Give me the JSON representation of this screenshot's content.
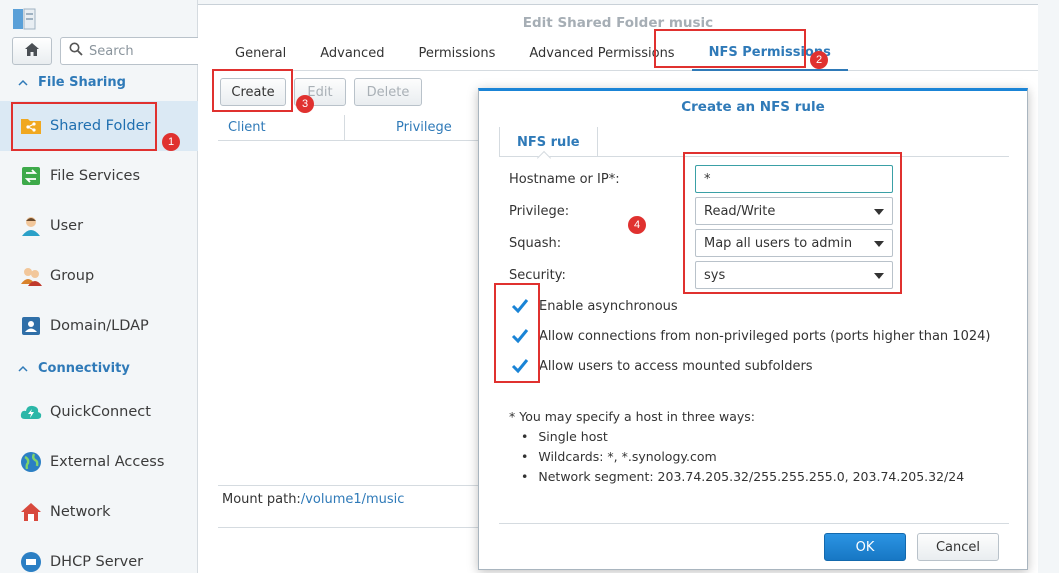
{
  "sidebar": {
    "search_placeholder": "Search",
    "sections": {
      "file_sharing": "File Sharing",
      "connectivity": "Connectivity"
    },
    "items": [
      {
        "label": "Shared Folder",
        "icon": "shared-folder-icon"
      },
      {
        "label": "File Services",
        "icon": "file-services-icon"
      },
      {
        "label": "User",
        "icon": "user-icon"
      },
      {
        "label": "Group",
        "icon": "group-icon"
      },
      {
        "label": "Domain/LDAP",
        "icon": "domain-ldap-icon"
      },
      {
        "label": "QuickConnect",
        "icon": "quickconnect-icon"
      },
      {
        "label": "External Access",
        "icon": "external-access-icon"
      },
      {
        "label": "Network",
        "icon": "network-icon"
      },
      {
        "label": "DHCP Server",
        "icon": "dhcp-server-icon"
      }
    ]
  },
  "window": {
    "title": "Edit Shared Folder music",
    "tabs": [
      "General",
      "Advanced",
      "Permissions",
      "Advanced Permissions",
      "NFS Permissions"
    ],
    "active_tab": "NFS Permissions",
    "toolbar": {
      "create": "Create",
      "edit": "Edit",
      "delete": "Delete"
    },
    "columns": [
      "Client",
      "Privilege"
    ],
    "mount_label": "Mount path:",
    "mount_value": "/volume1/music"
  },
  "dialog": {
    "title": "Create an NFS rule",
    "tab": "NFS rule",
    "fields": {
      "hostname_label": "Hostname or IP*:",
      "hostname_value": "*",
      "privilege_label": "Privilege:",
      "privilege_value": "Read/Write",
      "squash_label": "Squash:",
      "squash_value": "Map all users to admin",
      "security_label": "Security:",
      "security_value": "sys"
    },
    "checkboxes": [
      {
        "label": "Enable asynchronous",
        "checked": true
      },
      {
        "label": "Allow connections from non-privileged ports (ports higher than 1024)",
        "checked": true
      },
      {
        "label": "Allow users to access mounted subfolders",
        "checked": true
      }
    ],
    "note_heading": "* You may specify a host in three ways:",
    "note_items": [
      "Single host",
      "Wildcards: *, *.synology.com",
      "Network segment: 203.74.205.32/255.255.255.0, 203.74.205.32/24"
    ],
    "ok": "OK",
    "cancel": "Cancel"
  },
  "annotations": [
    "1",
    "2",
    "3",
    "4"
  ],
  "colors": {
    "accent": "#2f7ab8",
    "primary_button": "#1a84d6",
    "annotation": "#e0312f"
  }
}
